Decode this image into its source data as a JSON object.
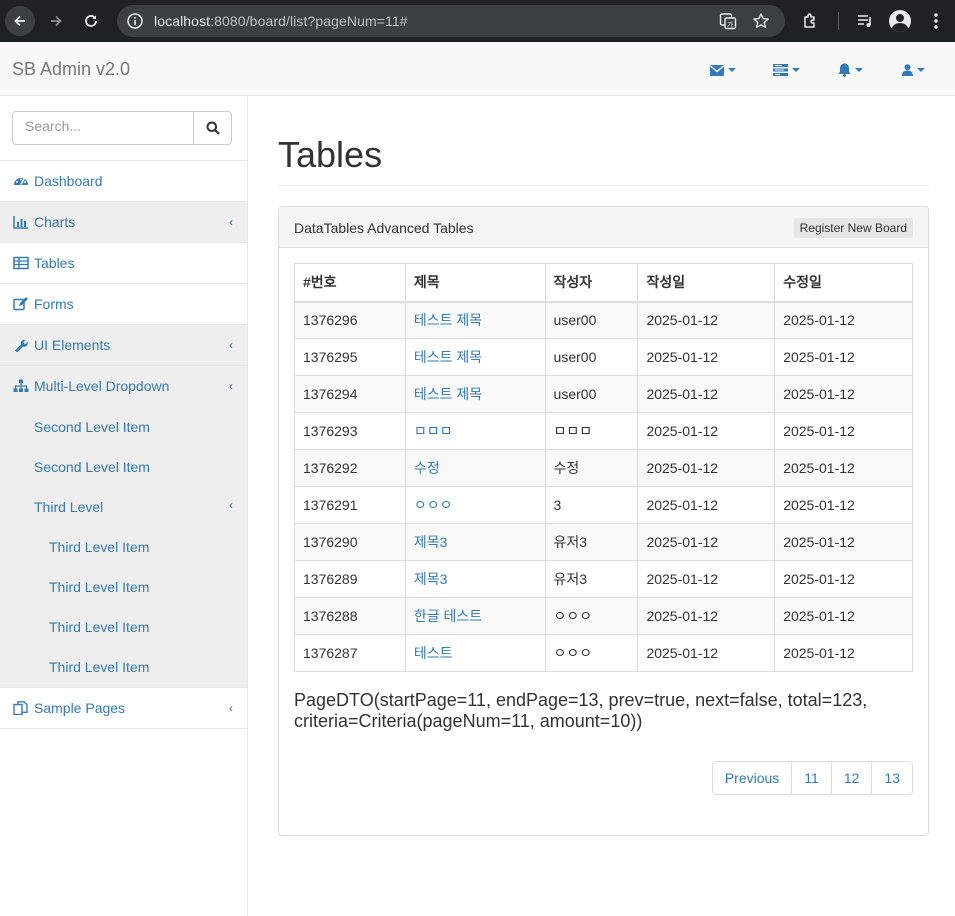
{
  "browser": {
    "url_host": "localhost",
    "url_rest": ":8080/board/list?pageNum=11#"
  },
  "navbar": {
    "brand": "SB Admin v2.0"
  },
  "sidebar": {
    "search_placeholder": "Search...",
    "items": [
      {
        "label": "Dashboard",
        "icon": "dashboard-icon"
      },
      {
        "label": "Charts",
        "icon": "bar-chart-icon"
      },
      {
        "label": "Tables",
        "icon": "table-icon"
      },
      {
        "label": "Forms",
        "icon": "edit-icon"
      },
      {
        "label": "UI Elements",
        "icon": "wrench-icon"
      },
      {
        "label": "Multi-Level Dropdown",
        "icon": "sitemap-icon"
      }
    ],
    "sub_items": [
      "Second Level Item",
      "Second Level Item",
      "Third Level"
    ],
    "third_items": [
      "Third Level Item",
      "Third Level Item",
      "Third Level Item",
      "Third Level Item"
    ],
    "sample_pages": "Sample Pages",
    "chevron": "‹"
  },
  "main": {
    "page_title": "Tables",
    "panel_title": "DataTables Advanced Tables",
    "register_button": "Register New Board",
    "columns": [
      "#번호",
      "제목",
      "작성자",
      "작성일",
      "수정일"
    ],
    "rows": [
      [
        "1376296",
        "테스트 제목",
        "user00",
        "2025-01-12",
        "2025-01-12"
      ],
      [
        "1376295",
        "테스트 제목",
        "user00",
        "2025-01-12",
        "2025-01-12"
      ],
      [
        "1376294",
        "테스트 제목",
        "user00",
        "2025-01-12",
        "2025-01-12"
      ],
      [
        "1376293",
        "ㅁㅁㅁ",
        "ㅁㅁㅁ",
        "2025-01-12",
        "2025-01-12"
      ],
      [
        "1376292",
        "수정",
        "수정",
        "2025-01-12",
        "2025-01-12"
      ],
      [
        "1376291",
        "ㅇㅇㅇ",
        "3",
        "2025-01-12",
        "2025-01-12"
      ],
      [
        "1376290",
        "제목3",
        "유저3",
        "2025-01-12",
        "2025-01-12"
      ],
      [
        "1376289",
        "제목3",
        "유저3",
        "2025-01-12",
        "2025-01-12"
      ],
      [
        "1376288",
        "한글 테스트",
        "ㅇㅇㅇ",
        "2025-01-12",
        "2025-01-12"
      ],
      [
        "1376287",
        "테스트",
        "ㅇㅇㅇ",
        "2025-01-12",
        "2025-01-12"
      ]
    ],
    "page_dto": "PageDTO(startPage=11, endPage=13, prev=true, next=false, total=123, criteria=Criteria(pageNum=11, amount=10))",
    "pagination": [
      "Previous",
      "11",
      "12",
      "13"
    ]
  },
  "colors": {
    "link": "#337ab7",
    "chrome_bg": "#202124"
  }
}
